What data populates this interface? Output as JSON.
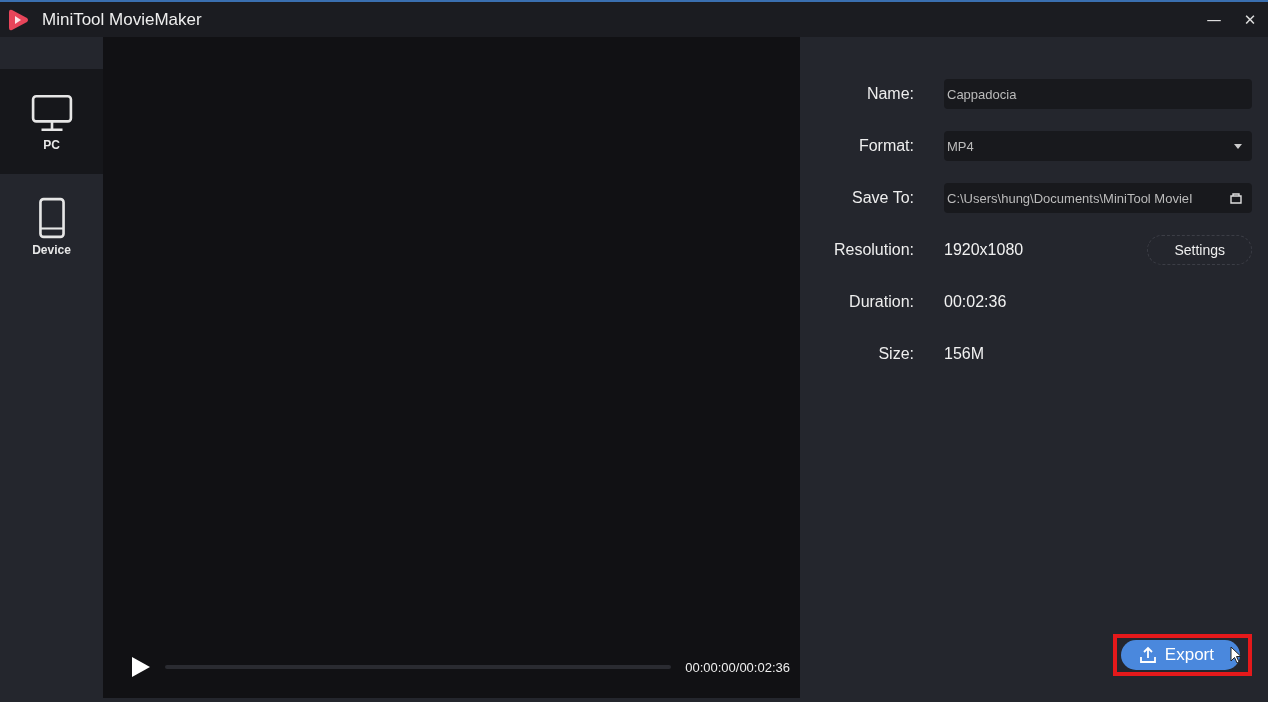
{
  "window": {
    "title": "MiniTool MovieMaker",
    "minimize": "—",
    "close": "✕"
  },
  "sidebar": {
    "items": [
      {
        "label": "PC",
        "kind": "monitor",
        "selected": true
      },
      {
        "label": "Device",
        "kind": "phone",
        "selected": false
      }
    ]
  },
  "player": {
    "time": "00:00:00/00:02:36"
  },
  "form": {
    "name": {
      "label": "Name:",
      "value": "Cappadocia"
    },
    "format": {
      "label": "Format:",
      "value": "MP4"
    },
    "save_to": {
      "label": "Save To:",
      "value": "C:\\Users\\hung\\Documents\\MiniTool MovieI"
    },
    "resolution": {
      "label": "Resolution:",
      "value": "1920x1080",
      "button": "Settings"
    },
    "duration": {
      "label": "Duration:",
      "value": "00:02:36"
    },
    "size": {
      "label": "Size:",
      "value": "156M"
    }
  },
  "export_button": {
    "label": "Export",
    "highlighted": true
  }
}
